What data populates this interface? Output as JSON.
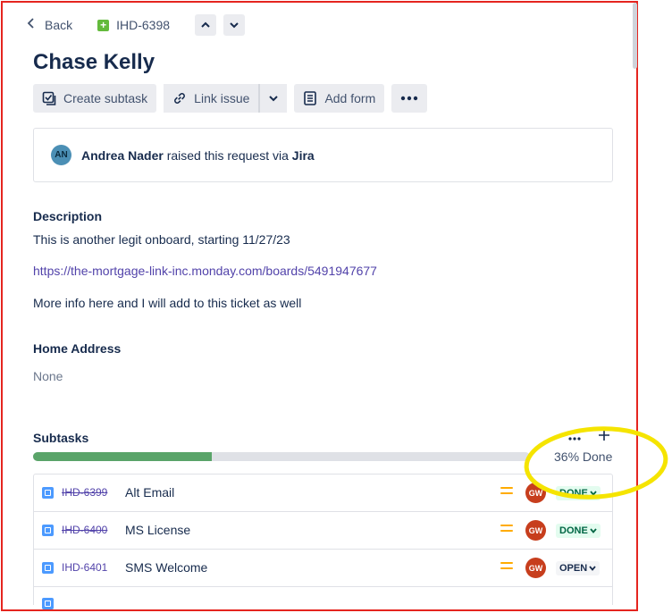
{
  "header": {
    "back_label": "Back",
    "issue_key": "IHD-6398"
  },
  "issue": {
    "title": "Chase Kelly"
  },
  "toolbar": {
    "create_subtask": "Create subtask",
    "link_issue": "Link issue",
    "add_form": "Add form"
  },
  "raised": {
    "avatar_initials": "AN",
    "reporter": "Andrea Nader",
    "middle_text": " raised this request via ",
    "channel": "Jira"
  },
  "description": {
    "heading": "Description",
    "line1": "This is another legit onboard, starting 11/27/23",
    "link": "https://the-mortgage-link-inc.monday.com/boards/5491947677",
    "line2": "More info here and I will add to this ticket as well"
  },
  "home_address": {
    "heading": "Home Address",
    "value": "None"
  },
  "subtasks": {
    "heading": "Subtasks",
    "progress_percent": 36,
    "progress_label": "36% Done",
    "rows": [
      {
        "key": "IHD-6399",
        "summary": "Alt Email",
        "assignee": "GW",
        "status": "DONE"
      },
      {
        "key": "IHD-6400",
        "summary": "MS License",
        "assignee": "GW",
        "status": "DONE"
      },
      {
        "key": "IHD-6401",
        "summary": "SMS Welcome",
        "assignee": "GW",
        "status": "OPEN"
      }
    ]
  },
  "colors": {
    "annotation": "#f5e400",
    "frame": "#e5251f"
  }
}
